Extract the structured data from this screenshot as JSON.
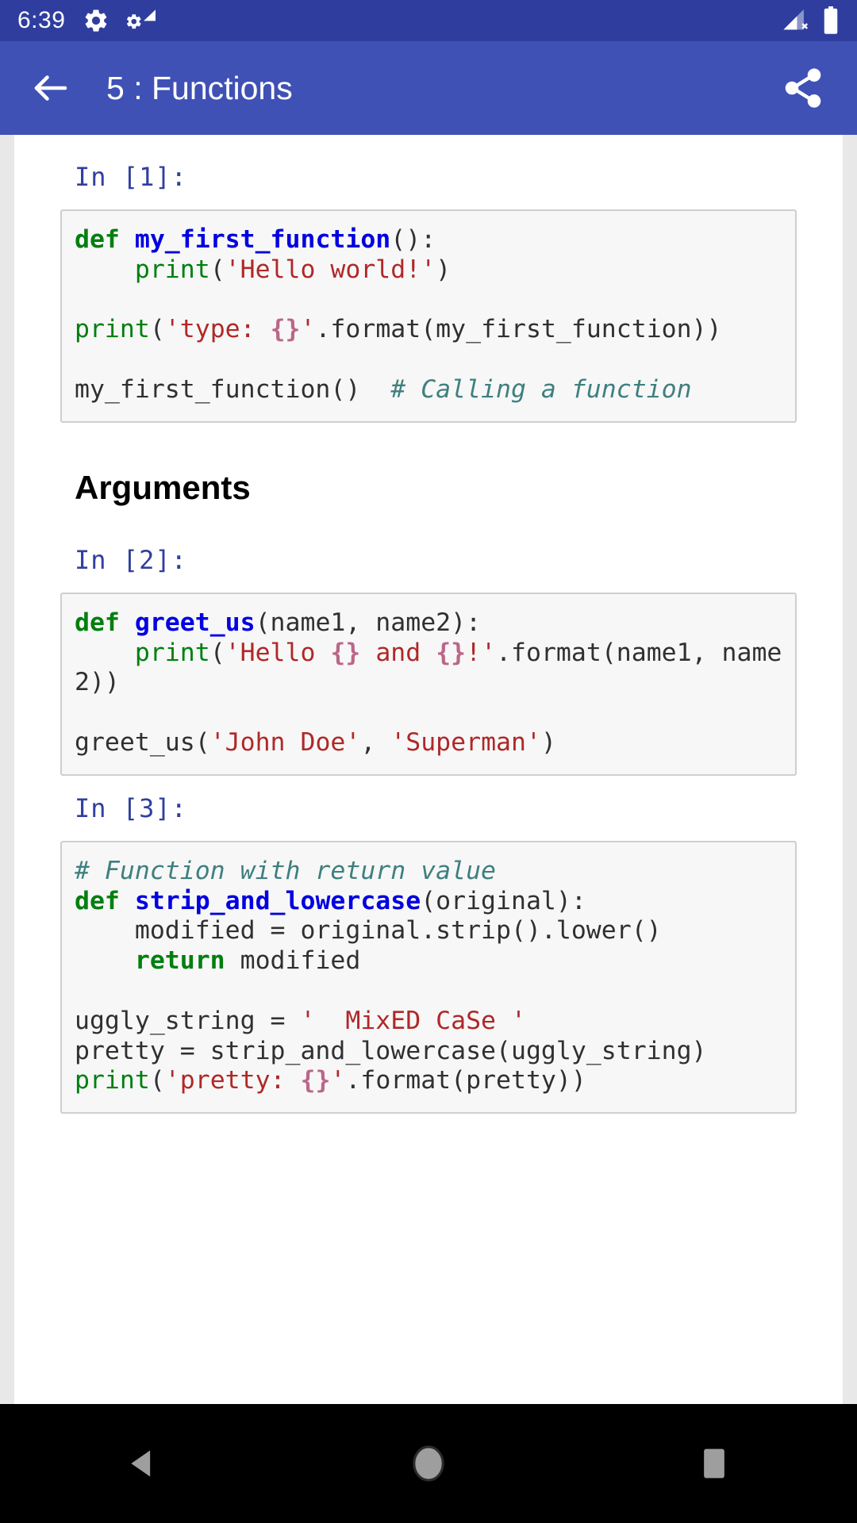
{
  "status_bar": {
    "time": "6:39",
    "icons_left": [
      "gear-icon",
      "gear-wifi-icon"
    ],
    "icons_right": [
      "signal-no-sim-icon",
      "battery-full-icon"
    ],
    "background_color": "#2F3E9E"
  },
  "app_bar": {
    "title": "5 : Functions",
    "back_icon": "arrow-back-icon",
    "share_icon": "share-icon",
    "background_color": "#3F51B5"
  },
  "notebook": {
    "cells": [
      {
        "type": "code",
        "prompt": "In [1]:",
        "source_plain": "def my_first_function():\n    print('Hello world!')\n\nprint('type: {}'.format(my_first_function))\n\nmy_first_function()  # Calling a function",
        "tokens": [
          {
            "t": "def",
            "c": "k"
          },
          {
            "t": " ",
            "c": "p"
          },
          {
            "t": "my_first_function",
            "c": "fn"
          },
          {
            "t": "():\n    ",
            "c": "p"
          },
          {
            "t": "print",
            "c": "bi"
          },
          {
            "t": "(",
            "c": "p"
          },
          {
            "t": "'Hello world!'",
            "c": "s"
          },
          {
            "t": ")\n\n",
            "c": "p"
          },
          {
            "t": "print",
            "c": "bi"
          },
          {
            "t": "(",
            "c": "p"
          },
          {
            "t": "'type: ",
            "c": "s"
          },
          {
            "t": "{}",
            "c": "fs"
          },
          {
            "t": "'",
            "c": "s"
          },
          {
            "t": ".format(my_first_function))\n\nmy_first_function()  ",
            "c": "p"
          },
          {
            "t": "# Calling a function",
            "c": "c"
          }
        ]
      },
      {
        "type": "markdown",
        "heading": "Arguments"
      },
      {
        "type": "code",
        "prompt": "In [2]:",
        "source_plain": "def greet_us(name1, name2):\n    print('Hello {} and {}!'.format(name1, name2))\n\ngreet_us('John Doe', 'Superman')",
        "tokens": [
          {
            "t": "def",
            "c": "k"
          },
          {
            "t": " ",
            "c": "p"
          },
          {
            "t": "greet_us",
            "c": "fn"
          },
          {
            "t": "(name1, name2):\n    ",
            "c": "p"
          },
          {
            "t": "print",
            "c": "bi"
          },
          {
            "t": "(",
            "c": "p"
          },
          {
            "t": "'Hello ",
            "c": "s"
          },
          {
            "t": "{}",
            "c": "fs"
          },
          {
            "t": " and ",
            "c": "s"
          },
          {
            "t": "{}",
            "c": "fs"
          },
          {
            "t": "!'",
            "c": "s"
          },
          {
            "t": ".format(name1, name2))\n\ngreet_us(",
            "c": "p"
          },
          {
            "t": "'John Doe'",
            "c": "s"
          },
          {
            "t": ", ",
            "c": "p"
          },
          {
            "t": "'Superman'",
            "c": "s"
          },
          {
            "t": ")",
            "c": "p"
          }
        ]
      },
      {
        "type": "code",
        "prompt": "In [3]:",
        "source_plain": "# Function with return value\ndef strip_and_lowercase(original):\n    modified = original.strip().lower()\n    return modified\n\nuggly_string = '  MixED CaSe '\npretty = strip_and_lowercase(uggly_string)\nprint('pretty: {}'.format(pretty))",
        "tokens": [
          {
            "t": "# Function with return value\n",
            "c": "c"
          },
          {
            "t": "def",
            "c": "k"
          },
          {
            "t": " ",
            "c": "p"
          },
          {
            "t": "strip_and_lowercase",
            "c": "fn"
          },
          {
            "t": "(original):\n    modified = original.strip().lower()\n    ",
            "c": "p"
          },
          {
            "t": "return",
            "c": "k"
          },
          {
            "t": " modified\n\nuggly_string = ",
            "c": "p"
          },
          {
            "t": "'  MixED CaSe '",
            "c": "s"
          },
          {
            "t": "\npretty = strip_and_lowercase(uggly_string)\n",
            "c": "p"
          },
          {
            "t": "print",
            "c": "bi"
          },
          {
            "t": "(",
            "c": "p"
          },
          {
            "t": "'pretty: ",
            "c": "s"
          },
          {
            "t": "{}",
            "c": "fs"
          },
          {
            "t": "'",
            "c": "s"
          },
          {
            "t": ".format(pretty))",
            "c": "p"
          }
        ]
      }
    ]
  },
  "nav_bar": {
    "buttons": [
      {
        "name": "back-triangle-icon"
      },
      {
        "name": "home-circle-icon"
      },
      {
        "name": "recents-square-icon"
      }
    ],
    "background_color": "#000000"
  }
}
